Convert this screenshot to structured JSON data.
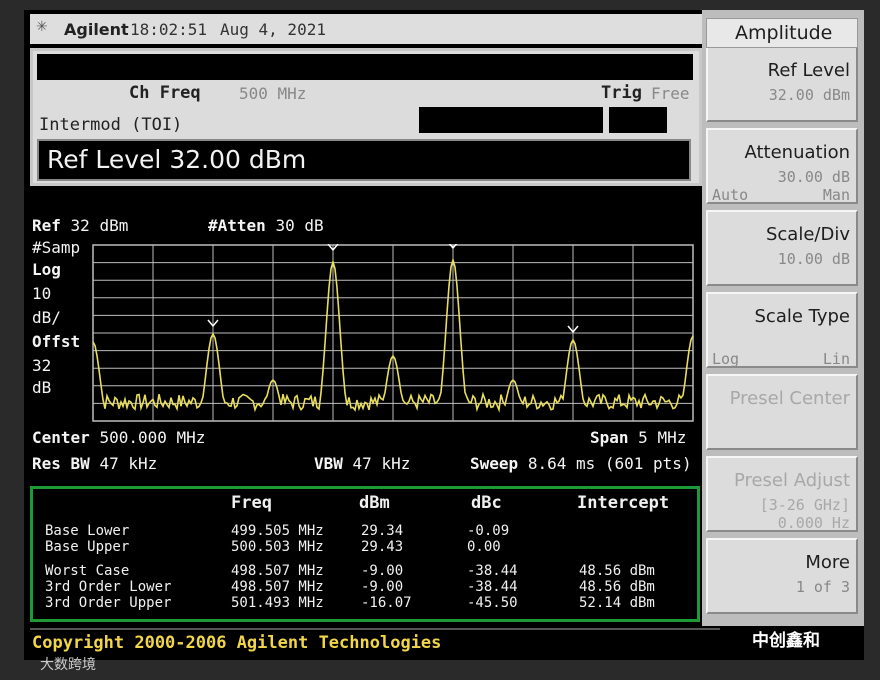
{
  "header": {
    "brand": "Agilent",
    "time": "18:02:51",
    "date": "Aug 4, 2021"
  },
  "info": {
    "ch_freq_label": "Ch Freq",
    "ch_freq_value": "500 MHz",
    "trig_label": "Trig",
    "trig_value": "Free",
    "measurement": "Intermod (TOI)",
    "active_entry": "Ref Level 32.00 dBm"
  },
  "plot": {
    "ref": "32 dBm",
    "ref_label": "Ref",
    "atten": "30 dB",
    "atten_label": "#Atten",
    "left_labels": [
      "#Samp",
      "Log",
      "10",
      "dB/",
      "Offst",
      "32",
      "dB"
    ],
    "center_label": "Center",
    "center": "500.000 MHz",
    "span_label": "Span",
    "span": "5 MHz",
    "rbw_label": "Res BW",
    "rbw": "47 kHz",
    "vbw_label": "VBW",
    "vbw": "47 kHz",
    "sweep_label": "Sweep",
    "sweep": "8.64 ms (601 pts)",
    "trace_color": "#e8de5c",
    "grid_color": "#bdbdbd"
  },
  "table": {
    "headers": [
      "Freq",
      "dBm",
      "dBc",
      "Intercept"
    ],
    "rows": [
      [
        "Base Lower",
        "499.505 MHz",
        "29.34",
        "-0.09",
        ""
      ],
      [
        "Base Upper",
        "500.503 MHz",
        "29.43",
        "0.00",
        ""
      ],
      [
        "Worst Case",
        "498.507 MHz",
        "-9.00",
        "-38.44",
        "48.56 dBm"
      ],
      [
        "3rd Order Lower",
        "498.507 MHz",
        "-9.00",
        "-38.44",
        "48.56 dBm"
      ],
      [
        "3rd Order Upper",
        "501.493 MHz",
        "-16.07",
        "-45.50",
        "52.14 dBm"
      ]
    ]
  },
  "copyright": "Copyright 2000-2006 Agilent Technologies",
  "softkeys": {
    "title": "Amplitude",
    "keys": [
      {
        "label": "Ref Level",
        "value": "32.00 dBm"
      },
      {
        "label": "Attenuation",
        "value": "30.00 dB",
        "left": "Auto",
        "right": "Man"
      },
      {
        "label": "Scale/Div",
        "value": "10.00 dB"
      },
      {
        "label": "Scale Type",
        "left": "Log",
        "right": "Lin"
      },
      {
        "label": "Presel Center"
      },
      {
        "label": "Presel Adjust",
        "value": "[3-26 GHz]",
        "value2": "0.000 Hz"
      },
      {
        "label": "More",
        "value": "1 of 3"
      }
    ]
  },
  "watermark": {
    "account": "中创鑫和",
    "source": "大数跨境"
  }
}
